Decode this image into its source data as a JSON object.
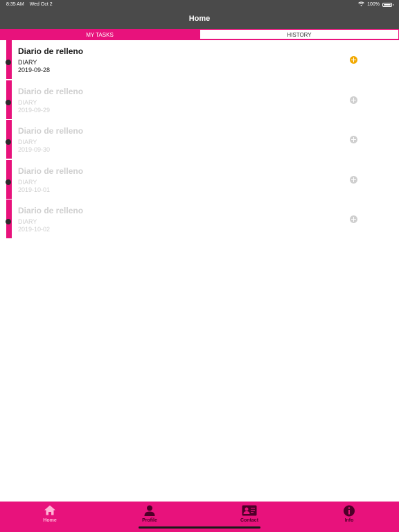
{
  "status_bar": {
    "time": "8:35 AM",
    "date": "Wed Oct 2",
    "battery": "100%"
  },
  "header": {
    "title": "Home"
  },
  "tabs": [
    {
      "label": "MY TASKS",
      "active": true
    },
    {
      "label": "HISTORY",
      "active": false
    }
  ],
  "tasks": [
    {
      "title": "Diario de relleno",
      "type": "DIARY",
      "date": "2019-09-28",
      "enabled": true
    },
    {
      "title": "Diario de relleno",
      "type": "DIARY",
      "date": "2019-09-29",
      "enabled": false
    },
    {
      "title": "Diario de relleno",
      "type": "DIARY",
      "date": "2019-09-30",
      "enabled": false
    },
    {
      "title": "Diario de relleno",
      "type": "DIARY",
      "date": "2019-10-01",
      "enabled": false
    },
    {
      "title": "Diario de relleno",
      "type": "DIARY",
      "date": "2019-10-02",
      "enabled": false
    }
  ],
  "bottom_nav": [
    {
      "label": "Home",
      "icon": "home-icon",
      "active": true
    },
    {
      "label": "Profile",
      "icon": "profile-icon",
      "active": false
    },
    {
      "label": "Contact",
      "icon": "contact-card-icon",
      "active": false
    },
    {
      "label": "Info",
      "icon": "info-icon",
      "active": false
    }
  ],
  "colors": {
    "accent": "#e8127c",
    "header_bg": "#4a4a4a",
    "add_enabled": "#f2a900",
    "disabled_text": "#cfcfcf"
  }
}
